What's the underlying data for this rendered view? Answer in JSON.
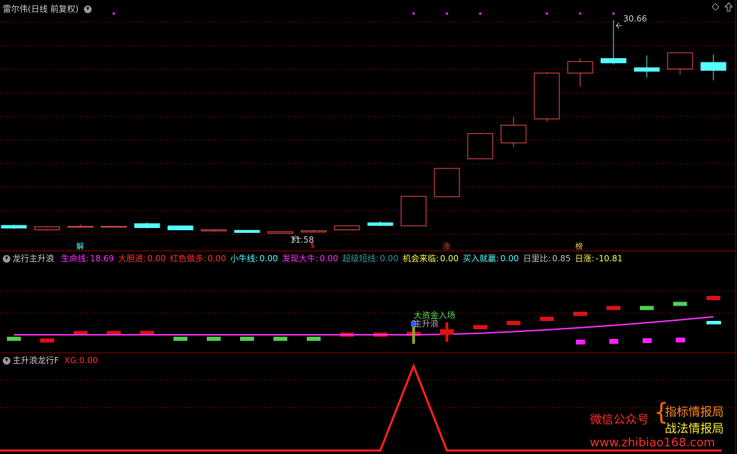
{
  "panel1": {
    "stock_name": "雷尔伟",
    "period": "(日线 前复权)",
    "high_label": "30.66",
    "low_label": "11.58",
    "markers": [
      {
        "text": "解",
        "color": "#55ffff"
      },
      {
        "text": "$",
        "color": "#ff3333"
      },
      {
        "text": "涨",
        "color": "#ff3333"
      },
      {
        "text": "榜",
        "color": "#ffcc66"
      }
    ]
  },
  "panel2": {
    "title": "龙行主升浪",
    "indicators": [
      {
        "name": "生命线:",
        "value": "18.69",
        "color": "#ff33ff"
      },
      {
        "name": "大胆进:",
        "value": "0.00",
        "color": "#ff3333"
      },
      {
        "name": "红色做多:",
        "value": "0.00",
        "color": "#ff3333"
      },
      {
        "name": "小牛线:",
        "value": "0.00",
        "color": "#55ffff"
      },
      {
        "name": "发现大牛:",
        "value": "0.00",
        "color": "#ff33ff"
      },
      {
        "name": "超级短线:",
        "value": "0.00",
        "color": "#339999"
      },
      {
        "name": "机会来临:",
        "value": "0.00",
        "color": "#ffff55"
      },
      {
        "name": "买入就赢:",
        "value": "0.00",
        "color": "#55ffff"
      },
      {
        "name": "日里比:",
        "value": "0.85",
        "color": "#c0c0c0"
      },
      {
        "name": "日涨:",
        "value": "-10.81",
        "color": "#ffff55"
      }
    ],
    "annotation_main": "大资金入场",
    "annotation_sub": "主升浪"
  },
  "panel3": {
    "title": "主升浪龙行F",
    "xg_label": "XG:",
    "xg_value": "0.00"
  },
  "watermark": {
    "left_text": "微信公众号",
    "right_top": "指标情报局",
    "right_bottom": "战法情报局",
    "url": "www.zhibiao168.com"
  },
  "colors": {
    "up": "#ff5555",
    "down": "#55ffff",
    "grid": "#8b0000",
    "life_line": "#ff33ff",
    "xg_line": "#ff2222"
  },
  "chart_data": {
    "type": "candlestick",
    "candles": [
      {
        "o": 12.45,
        "h": 12.55,
        "l": 12.05,
        "c": 12.15
      },
      {
        "o": 11.95,
        "h": 12.4,
        "l": 11.9,
        "c": 12.3
      },
      {
        "o": 12.3,
        "h": 12.55,
        "l": 12.2,
        "c": 12.35
      },
      {
        "o": 12.3,
        "h": 12.4,
        "l": 12.25,
        "c": 12.35
      },
      {
        "o": 12.65,
        "h": 12.8,
        "l": 12.1,
        "c": 12.2
      },
      {
        "o": 12.4,
        "h": 12.45,
        "l": 11.9,
        "c": 11.95
      },
      {
        "o": 11.85,
        "h": 12.0,
        "l": 11.75,
        "c": 11.95
      },
      {
        "o": 11.9,
        "h": 11.95,
        "l": 11.6,
        "c": 11.65
      },
      {
        "o": 11.58,
        "h": 11.8,
        "l": 11.58,
        "c": 11.75
      },
      {
        "o": 11.7,
        "h": 12.0,
        "l": 11.65,
        "c": 11.85
      },
      {
        "o": 11.95,
        "h": 12.45,
        "l": 11.95,
        "c": 12.4
      },
      {
        "o": 12.75,
        "h": 12.95,
        "l": 12.35,
        "c": 12.45
      },
      {
        "o": 12.4,
        "h": 15.8,
        "l": 12.35,
        "c": 15.75
      },
      {
        "o": 15.7,
        "h": 18.95,
        "l": 15.65,
        "c": 18.9
      },
      {
        "o": 20.0,
        "h": 22.95,
        "l": 20.0,
        "c": 22.85
      },
      {
        "o": 21.8,
        "h": 24.75,
        "l": 21.3,
        "c": 23.8
      },
      {
        "o": 24.5,
        "h": 29.8,
        "l": 24.2,
        "c": 29.7
      },
      {
        "o": 29.7,
        "h": 31.4,
        "l": 28.2,
        "c": 31.0
      },
      {
        "o": 31.35,
        "h": 35.7,
        "l": 30.66,
        "c": 30.85
      },
      {
        "o": 30.3,
        "h": 31.7,
        "l": 29.2,
        "c": 29.9
      },
      {
        "o": 30.15,
        "h": 32.0,
        "l": 29.5,
        "c": 32.0
      },
      {
        "o": 30.9,
        "h": 31.8,
        "l": 28.9,
        "c": 30.0
      }
    ],
    "signal_bars": [
      {
        "color": "#55cc55",
        "v": -0.4
      },
      {
        "color": "#dd1111",
        "v": -0.6
      },
      {
        "color": "#dd1111",
        "v": 0.3
      },
      {
        "color": "#dd1111",
        "v": 0.3
      },
      {
        "color": "#dd1111",
        "v": 0.3
      },
      {
        "color": "#55cc55",
        "v": -0.4
      },
      {
        "color": "#55cc55",
        "v": -0.4
      },
      {
        "color": "#55cc55",
        "v": -0.4
      },
      {
        "color": "#55cc55",
        "v": -0.4
      },
      {
        "color": "#55cc55",
        "v": -0.4
      },
      {
        "color": "#dd1111",
        "v": 0.1
      },
      {
        "color": "#dd1111",
        "v": 0.1
      },
      {
        "color": "#dd1111",
        "v": 0.2
      },
      {
        "color": "#dd1111",
        "v": 0.5
      },
      {
        "color": "#dd1111",
        "v": 1.0
      },
      {
        "color": "#dd1111",
        "v": 1.5
      },
      {
        "color": "#dd1111",
        "v": 2.0
      },
      {
        "color": "#dd1111",
        "v": 2.6
      },
      {
        "color": "#dd1111",
        "v": 3.3
      },
      {
        "color": "#55cc55",
        "v": 3.3
      },
      {
        "color": "#55cc55",
        "v": 3.8
      },
      {
        "color": "#dd1111",
        "v": 4.5
      }
    ],
    "magenta_bars": [
      17,
      18,
      19,
      20
    ],
    "cyan_bar": 21,
    "xg": [
      0,
      0,
      0,
      0,
      0,
      0,
      0,
      0,
      0,
      0,
      0,
      0,
      1,
      0,
      0,
      0,
      0,
      0,
      0,
      0,
      0,
      0
    ]
  }
}
